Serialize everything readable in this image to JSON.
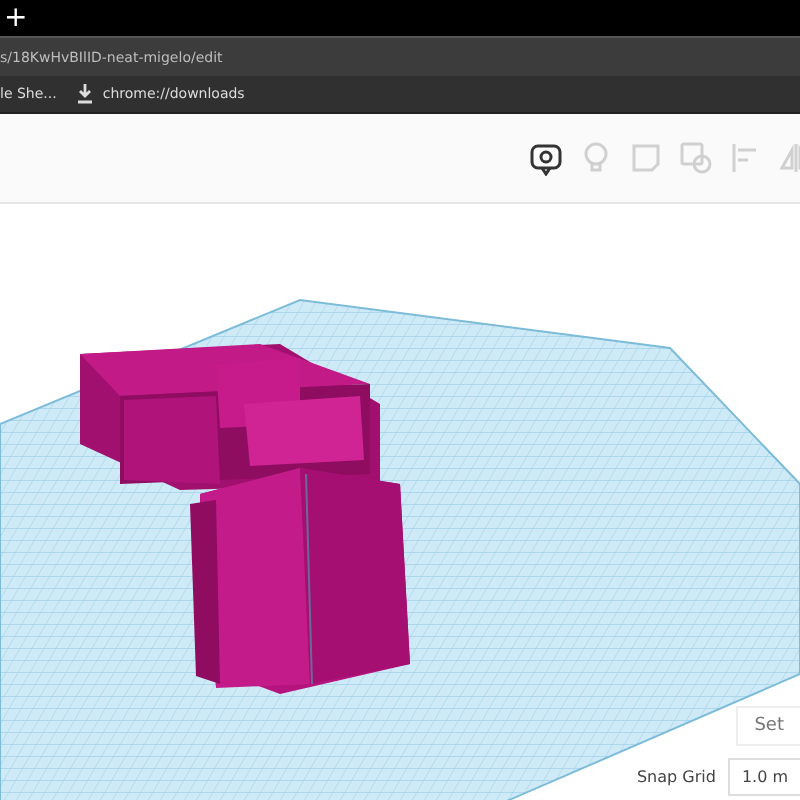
{
  "browser": {
    "new_tab": "+",
    "address": "s/18KwHvBIlID-neat-migelo/edit",
    "bookmarks": [
      {
        "label": "le She...",
        "kind": "page"
      },
      {
        "label": "chrome://downloads",
        "kind": "download"
      }
    ]
  },
  "toolbar": {
    "tools": [
      {
        "kind": "view",
        "disabled": false
      },
      {
        "kind": "bulb",
        "disabled": true
      },
      {
        "kind": "note",
        "disabled": true
      },
      {
        "kind": "group",
        "disabled": true
      },
      {
        "kind": "align",
        "disabled": true
      },
      {
        "kind": "mirror",
        "disabled": true
      }
    ]
  },
  "settings": {
    "button": "Set",
    "snap_label": "Snap Grid",
    "snap_value": "1.0 m"
  }
}
